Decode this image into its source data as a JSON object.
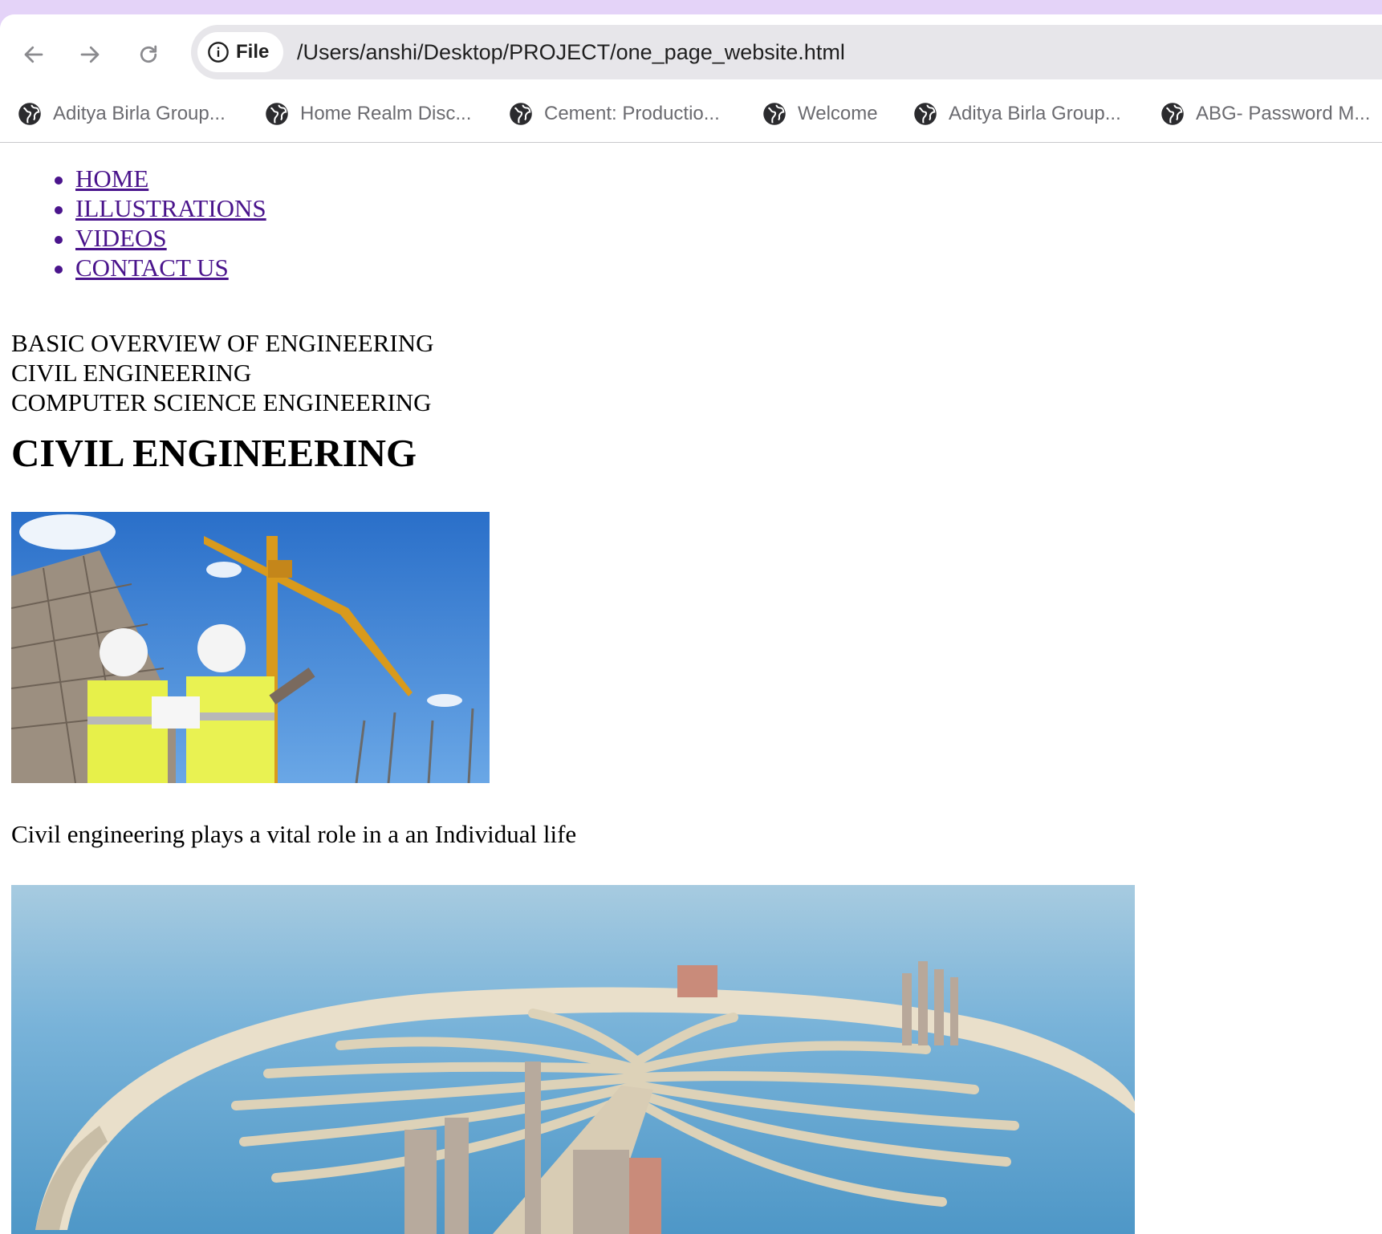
{
  "browser": {
    "site_chip_label": "File",
    "url": "/Users/anshi/Desktop/PROJECT/one_page_website.html",
    "bookmarks": [
      {
        "label": "Aditya Birla Group..."
      },
      {
        "label": "Home Realm Disc..."
      },
      {
        "label": "Cement: Productio..."
      },
      {
        "label": "Welcome"
      },
      {
        "label": "Aditya Birla Group..."
      },
      {
        "label": "ABG- Password M..."
      }
    ]
  },
  "page": {
    "nav": [
      {
        "label": "HOME"
      },
      {
        "label": "ILLUSTRATIONS"
      },
      {
        "label": "VIDEOS"
      },
      {
        "label": "CONTACT US"
      }
    ],
    "sections": [
      "BASIC OVERVIEW OF ENGINEERING",
      "CIVIL ENGINEERING",
      "COMPUTER SCIENCE ENGINEERING"
    ],
    "heading": "CIVIL ENGINEERING",
    "caption": "Civil engineering plays a vital role in a an Individual life"
  },
  "colors": {
    "frame_accent": "#e4d3f8",
    "link": "#4a148c",
    "omnibox": "#e7e6ea"
  }
}
